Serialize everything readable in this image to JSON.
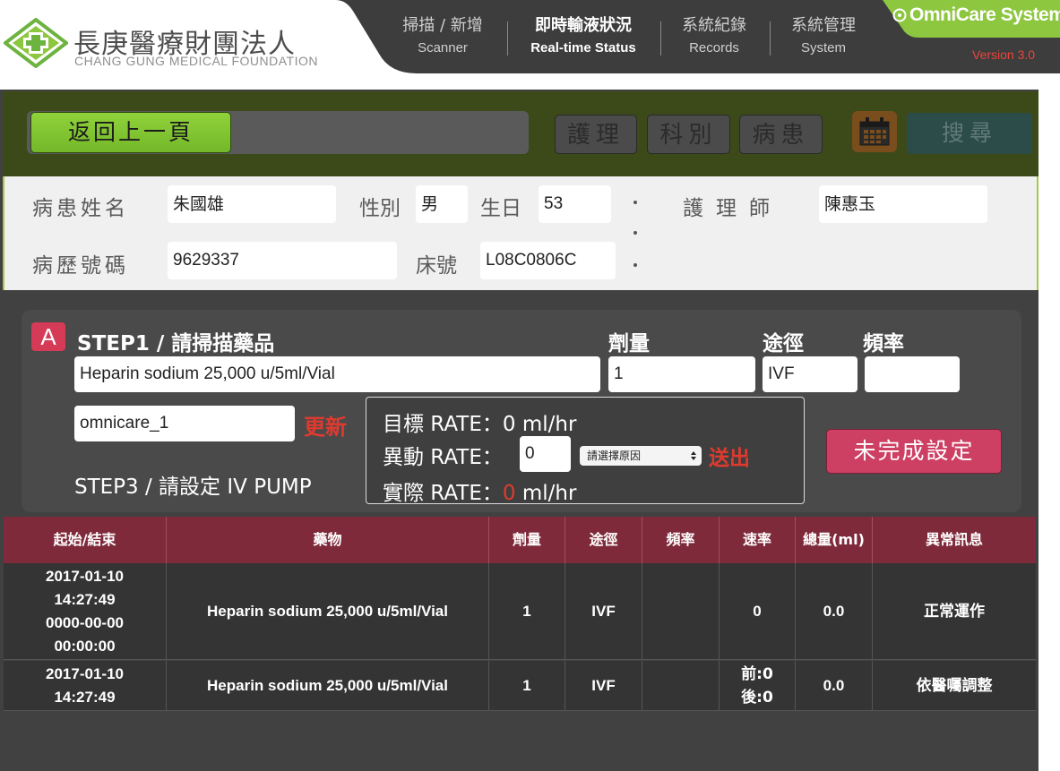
{
  "header": {
    "org_name_cn": "長庚醫療財團法人",
    "org_name_en": "CHANG GUNG MEDICAL FOUNDATION",
    "brand": "OmniCare System",
    "version": "Version 3.0",
    "nav": [
      {
        "cn": "掃描 / 新增",
        "en": "Scanner",
        "active": false
      },
      {
        "cn": "即時輸液狀況",
        "en": "Real-time Status",
        "active": true
      },
      {
        "cn": "系統紀錄",
        "en": "Records",
        "active": false
      },
      {
        "cn": "系統管理",
        "en": "System",
        "active": false
      }
    ]
  },
  "toolbar": {
    "back_label": "返回上一頁",
    "nursing_label": "護理",
    "department_label": "科別",
    "patient_label": "病患",
    "search_label": "搜尋"
  },
  "patient": {
    "name_label": "病患姓名",
    "name_value": "朱國雄",
    "gender_label": "性別",
    "gender_value": "男",
    "birthday_label": "生日",
    "birthday_value": "53",
    "nurse_label": "護理師",
    "nurse_value": "陳惠玉",
    "record_label": "病歷號碼",
    "record_value": "9629337",
    "bed_label": "床號",
    "bed_value": "L08C0806C"
  },
  "step": {
    "badge": "A",
    "step1_label": "STEP1 / 請掃描藥品",
    "drug_value": "Heparin sodium  25,000 u/5ml/Vial",
    "dose_label": "劑量",
    "dose_value": "1",
    "route_label": "途徑",
    "route_value": "IVF",
    "freq_label": "頻率",
    "freq_value": "",
    "pump_value": "omnicare_1",
    "update_label": "更新",
    "step3_label": "STEP3 / 請設定 IV PUMP",
    "target_rate_label": "目標 RATE：",
    "target_rate_value": "0 ml/hr",
    "change_rate_label": "異動 RATE：",
    "change_rate_value": "0",
    "reason_placeholder": "請選擇原因",
    "send_label": "送出",
    "actual_rate_label": "實際 RATE：",
    "actual_rate_value": "0",
    "actual_rate_unit": " ml/hr",
    "unfinished_label": "未完成設定"
  },
  "table": {
    "headers": [
      "起始/結束",
      "藥物",
      "劑量",
      "途徑",
      "頻率",
      "速率",
      "總量(ml)",
      "異常訊息"
    ],
    "rows": [
      {
        "start": "2017-01-10",
        "start_time": "14:27:49",
        "end": "0000-00-00",
        "end_time": "00:00:00",
        "drug": "Heparin sodium 25,000 u/5ml/Vial",
        "dose": "1",
        "route": "IVF",
        "freq": "",
        "rate": "0",
        "total": "0.0",
        "message": "正常運作"
      },
      {
        "start": "2017-01-10",
        "start_time": "14:27:49",
        "drug": "Heparin sodium 25,000 u/5ml/Vial",
        "dose": "1",
        "route": "IVF",
        "freq": "",
        "rate_before": "前:0",
        "rate_after": "後:0",
        "total": "0.0",
        "message": "依醫囑調整"
      }
    ]
  },
  "colors": {
    "brand_green": "#8dc63f",
    "header_dark": "#3c3c3c",
    "accent_red": "#e03a2f",
    "table_header": "#7f2a3a",
    "toolbar_olive": "#3b4a18"
  }
}
